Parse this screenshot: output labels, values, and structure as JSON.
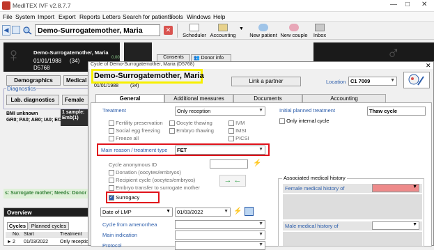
{
  "app": {
    "title": "MedITEX IVF v2.8.7.7"
  },
  "menu": [
    "File",
    "System",
    "Import",
    "Export",
    "Reports",
    "Letters",
    "Search for patients",
    "Tools",
    "Windows",
    "Help"
  ],
  "toolbar": {
    "patient_name": "Demo-Surrogatemother, Maria",
    "scheduler": "Scheduler",
    "accounting": "Accounting",
    "new_patient": "New patient",
    "new_couple": "New couple",
    "inbox": "Inbox"
  },
  "patient_card": {
    "name": "Demo-Surrogatemother, Maria",
    "dob": "01/01/1988",
    "age": "(34)",
    "id": "D5768"
  },
  "left": {
    "demographics": "Demographics",
    "medical": "Medical",
    "diagnostics_label": "Diagnostics",
    "lab_diagnostics": "Lab. diagnostics",
    "female": "Female",
    "bmi": "BMI unknown",
    "gr": "GR0; PA0; AB0; IA0; EC0",
    "sample_label": "1 sample:",
    "sample_value": "Emb(1)",
    "status_text": "s: Surrogate mother; Needs: Donor (",
    "overview_title": "Overview",
    "tab_cycles": "Cycles",
    "tab_planned": "Planned cycles",
    "col_no": "No.",
    "col_start": "Start",
    "col_treatment": "Treatment",
    "row_no": "2",
    "row_start": "01/03/2022",
    "row_treatment": "Only reception"
  },
  "side_tabs": {
    "consents": "Consents",
    "donor_info": "Donor info"
  },
  "dialog": {
    "title": "Cycle of Demo-Surrogatemother, Maria (D5768)",
    "patient_name": "Demo-Surrogatemother, Maria",
    "dob": "01/01/1988",
    "age": "(34)",
    "link_partner": "Link a partner",
    "location_label": "Location",
    "location_value": "C1 7009",
    "tabs": [
      "General",
      "Additional measures",
      "Documents",
      "Accounting"
    ],
    "treatment_label": "Treatment",
    "treatment_value": "Only reception",
    "initial_planned_label": "Initial planned treatment",
    "initial_planned_value": "Thaw cycle",
    "only_internal": "Only internal cycle",
    "checkboxes_col1": [
      "Fertility preservation",
      "Social egg freezing",
      "Freeze all"
    ],
    "checkboxes_col2": [
      "Oocyte thawing",
      "Embryo thawing"
    ],
    "checkboxes_col3": [
      "IVM",
      "IMSI",
      "PICSI"
    ],
    "main_reason_label": "Main reason / treatment type",
    "main_reason_value": "FET",
    "cycle_anon_label": "Cycle anonymous ID",
    "donation": "Donation (oocytes/embryos)",
    "recipient": "Recipient cycle (oocytes/embryos)",
    "embryo_transfer": "Embryo transfer to surrogate mother",
    "surrogacy": "Surrogacy",
    "date_lmp_label": "Date of LMP",
    "date_lmp_value": "01/03/2022",
    "cycle_amenorrhea": "Cycle from amenorrhea",
    "main_indication": "Main indication",
    "protocol": "Protocol",
    "assoc_history": "Associated medical history",
    "female_history": "Female medical history of",
    "male_history": "Male medical history of"
  },
  "colors": {
    "accent_red": "#e0121a",
    "highlight_yellow": "#f7f000",
    "status_green": "#2e7d32"
  }
}
